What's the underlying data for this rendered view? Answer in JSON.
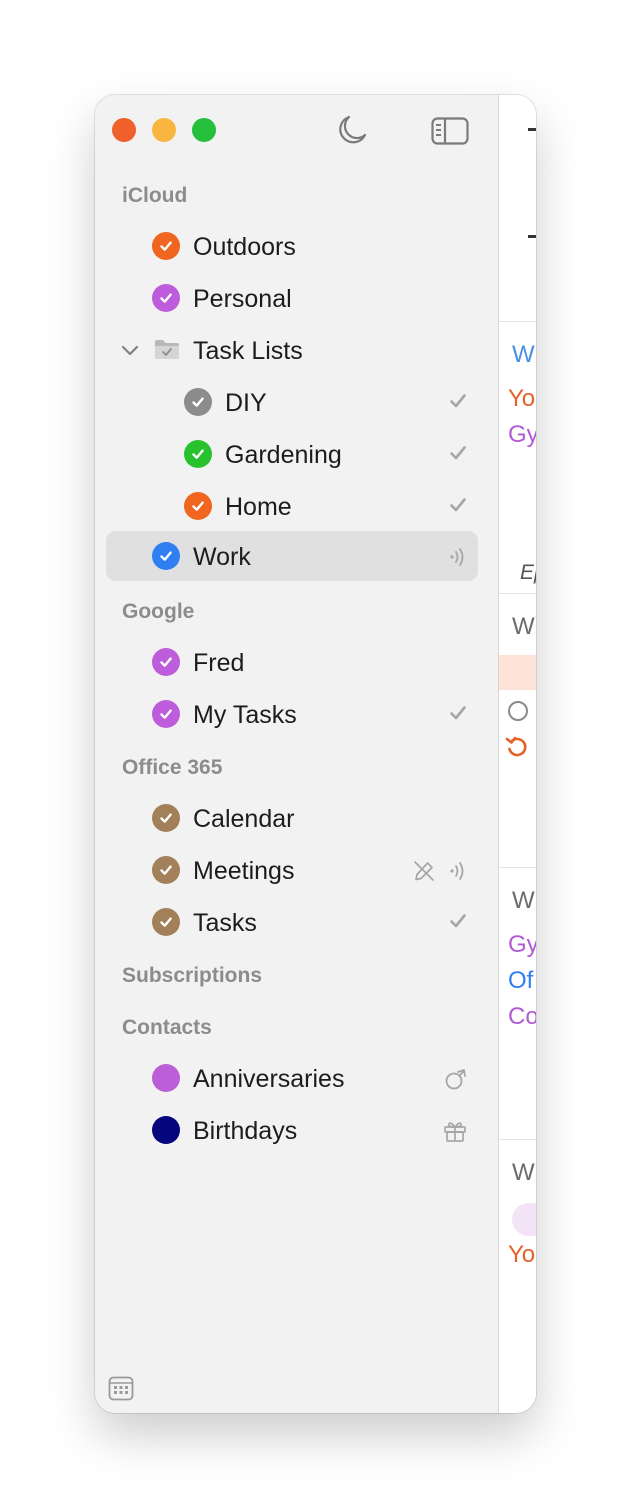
{
  "icons": {
    "check": "checkmark-icon",
    "broadcast": "broadcast-icon",
    "pencil_off": "pencil-slash-icon",
    "tag": "tag-icon",
    "gift": "gift-icon",
    "moon": "moon-icon",
    "sidebar": "sidebar-toggle-icon",
    "calendar": "calendar-grid-icon"
  },
  "sections": {
    "icloud": "iCloud",
    "google": "Google",
    "office": "Office 365",
    "subscriptions": "Subscriptions",
    "contacts": "Contacts"
  },
  "lists": {
    "outdoors": {
      "label": "Outdoors",
      "color": "#f0651f"
    },
    "personal": {
      "label": "Personal",
      "color": "#bd5ddb"
    },
    "task_lists": {
      "label": "Task Lists"
    },
    "diy": {
      "label": "DIY",
      "color": "#8c8c8c"
    },
    "gardening": {
      "label": "Gardening",
      "color": "#28c22f"
    },
    "home": {
      "label": "Home",
      "color": "#f0651f"
    },
    "work": {
      "label": "Work",
      "color": "#2f7ff2"
    },
    "fred": {
      "label": "Fred",
      "color": "#bd5ddb"
    },
    "my_tasks": {
      "label": "My Tasks",
      "color": "#bd5ddb"
    },
    "calendar": {
      "label": "Calendar",
      "color": "#a1805a"
    },
    "meetings": {
      "label": "Meetings",
      "color": "#a1805a"
    },
    "tasks": {
      "label": "Tasks",
      "color": "#a1805a"
    },
    "anniversaries": {
      "label": "Anniversaries",
      "color": "#bb5ed8"
    },
    "birthdays": {
      "label": "Birthdays",
      "color": "#05057e"
    }
  },
  "content_preview": {
    "w1": "W",
    "yo1": "Yo",
    "gy1": "Gy",
    "ep": "Ep",
    "w2": "W",
    "w3": "W",
    "gy2": "Gy",
    "of": "Of",
    "co": "Co",
    "w4": "W",
    "yo2": "Yo"
  }
}
